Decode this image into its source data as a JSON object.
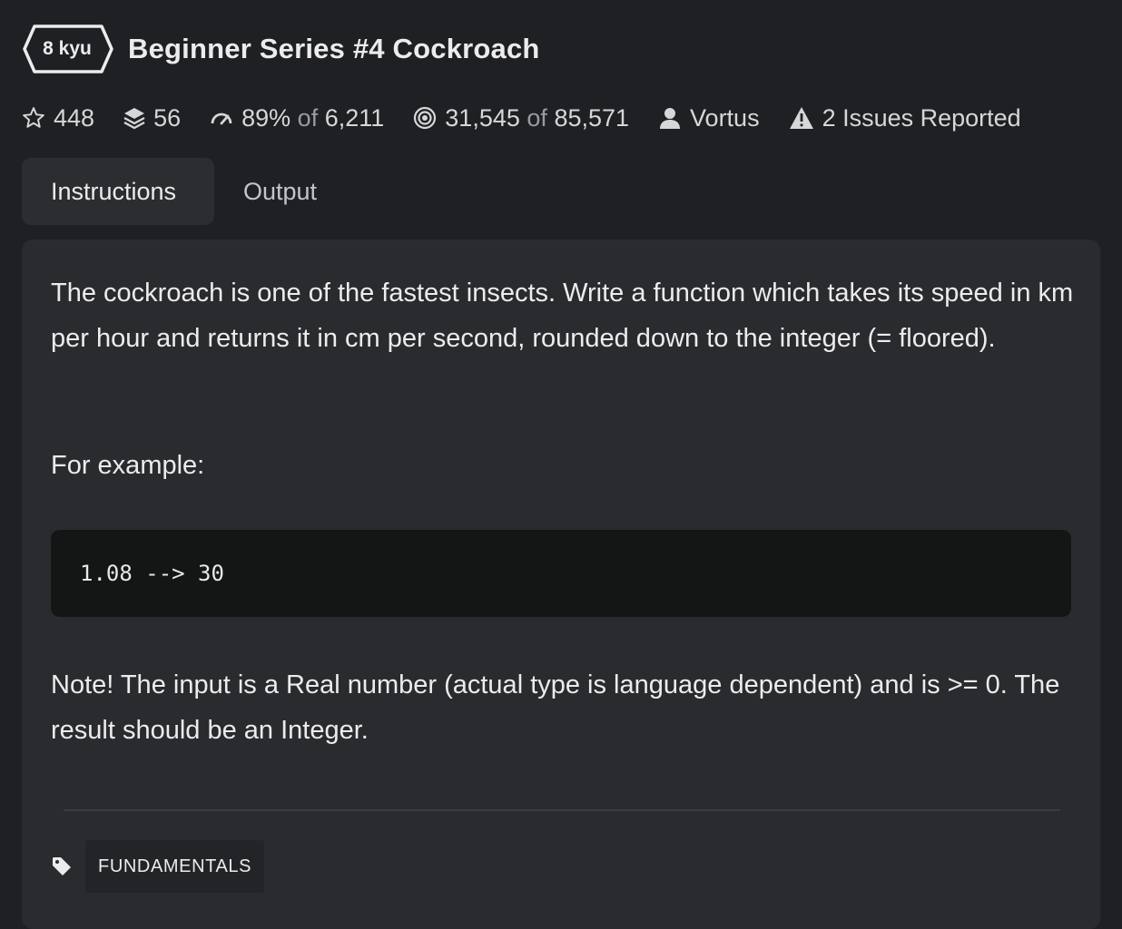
{
  "kata": {
    "rank": "8 kyu",
    "title": "Beginner Series #4 Cockroach"
  },
  "stats": {
    "stars": "448",
    "collections": "56",
    "satisfaction": "89%",
    "satisfaction_of": "of",
    "satisfaction_total": "6,211",
    "completed": "31,545",
    "completed_of": "of",
    "completed_total": "85,571",
    "author": "Vortus",
    "issues": "2 Issues Reported"
  },
  "tabs": [
    {
      "label": "Instructions",
      "active": true
    },
    {
      "label": "Output",
      "active": false
    }
  ],
  "description": {
    "paragraph1": "The cockroach is one of the fastest insects. Write a function which takes its speed in km per hour and returns it in cm per second, rounded down to the integer (= floored).",
    "paragraph2": "For example:",
    "code": "1.08 --> 30",
    "paragraph3": "Note! The input is a Real number (actual type is language dependent) and is >= 0. The result should be an Integer."
  },
  "tags": [
    "FUNDAMENTALS"
  ],
  "icons": {
    "stars": "star-outline-icon",
    "collections": "layers-icon",
    "satisfaction": "gauge-icon",
    "completed": "target-icon",
    "author": "user-icon",
    "issues": "warning-icon",
    "tags": "tag-icon"
  },
  "colors": {
    "background": "#1f2023",
    "panel": "#2a2b2f",
    "code_background": "#141515",
    "text": "#ececed",
    "muted": "#9a9ba0"
  }
}
